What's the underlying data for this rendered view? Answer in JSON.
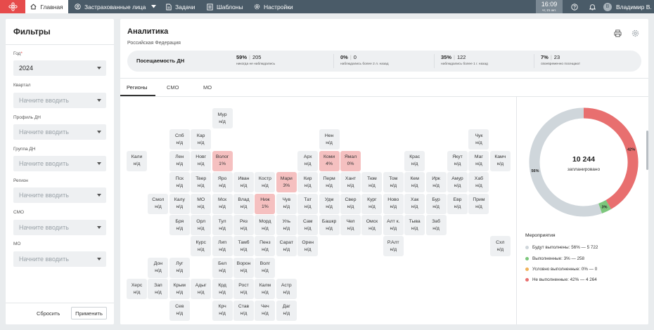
{
  "colors": {
    "topbar": "#4a5b68",
    "accent": "#e64b4b",
    "tile": "#eef0f2",
    "tile_red": "#f5c0c0",
    "planned": "#cfd6db",
    "done": "#7cc77c",
    "conditional": "#f0b35a",
    "not_done": "#e86f6f"
  },
  "topbar": {
    "logo_icon": "flower-logo-icon",
    "nav": [
      {
        "label": "Главная",
        "icon": "home-icon"
      },
      {
        "label": "Застрахованные лица",
        "icon": "person-circle-icon"
      },
      {
        "label": "Задачи",
        "icon": "document-icon"
      },
      {
        "label": "Шаблоны",
        "icon": "template-icon"
      },
      {
        "label": "Настройки",
        "icon": "gear-icon"
      }
    ],
    "time": "16:09",
    "date": "чт, 21 окт.",
    "user_initial": "В",
    "user_name": "Владимир В."
  },
  "filters": {
    "title": "Фильтры",
    "year_label": "Год",
    "year_required": "*",
    "year_value": "2024",
    "fields": [
      {
        "label": "Квартал",
        "placeholder": "Начните вводить"
      },
      {
        "label": "Профиль ДН",
        "placeholder": "Начните вводить"
      },
      {
        "label": "Группа ДН",
        "placeholder": "Начните вводить"
      },
      {
        "label": "Регион",
        "placeholder": "Начните вводить"
      },
      {
        "label": "СМО",
        "placeholder": "Начните вводить"
      },
      {
        "label": "МО",
        "placeholder": "Начните вводить"
      }
    ],
    "reset": "Сбросить",
    "apply": "Применить"
  },
  "main": {
    "title": "Аналитика",
    "subtitle": "Российская Федерация",
    "stats_label": "Посещаемость ДН",
    "stats": [
      {
        "pct": "59%",
        "count": "205",
        "desc": "никогда не наблюдались"
      },
      {
        "pct": "0%",
        "count": "0",
        "desc": "наблюдались более 2 л. назад"
      },
      {
        "pct": "35%",
        "count": "122",
        "desc": "наблюдались более 1 г. назад"
      },
      {
        "pct": "7%",
        "count": "23",
        "desc": "своевременно посещают"
      }
    ],
    "tabs": [
      "Регионы",
      "СМО",
      "МО"
    ],
    "tiles": [
      [
        "Мур",
        "н/д",
        4,
        0,
        0
      ],
      [
        "Спб",
        "н/д",
        2,
        1,
        0
      ],
      [
        "Кар",
        "н/д",
        3,
        1,
        0
      ],
      [
        "Нен",
        "н/д",
        9,
        1,
        0
      ],
      [
        "Чук",
        "н/д",
        16,
        1,
        0
      ],
      [
        "Кали",
        "н/д",
        0,
        2,
        0
      ],
      [
        "Лен",
        "н/д",
        2,
        2,
        0
      ],
      [
        "Новг",
        "н/д",
        3,
        2,
        0
      ],
      [
        "Волог",
        "1%",
        4,
        2,
        1
      ],
      [
        "Арх",
        "н/д",
        8,
        2,
        0
      ],
      [
        "Коми",
        "4%",
        9,
        2,
        1
      ],
      [
        "Ямал",
        "0%",
        10,
        2,
        1
      ],
      [
        "Крас",
        "н/д",
        13,
        2,
        0
      ],
      [
        "Якут",
        "н/д",
        15,
        2,
        0
      ],
      [
        "Маг",
        "н/д",
        16,
        2,
        0
      ],
      [
        "Камч",
        "н/д",
        17,
        2,
        0
      ],
      [
        "Пск",
        "н/д",
        2,
        3,
        0
      ],
      [
        "Твер",
        "н/д",
        3,
        3,
        0
      ],
      [
        "Яро",
        "н/д",
        4,
        3,
        0
      ],
      [
        "Иван",
        "н/д",
        5,
        3,
        0
      ],
      [
        "Костр",
        "н/д",
        6,
        3,
        0
      ],
      [
        "Мари",
        "3%",
        7,
        3,
        1
      ],
      [
        "Кир",
        "н/д",
        8,
        3,
        0
      ],
      [
        "Перм",
        "н/д",
        9,
        3,
        0
      ],
      [
        "Хант",
        "н/д",
        10,
        3,
        0
      ],
      [
        "Тюм",
        "н/д",
        11,
        3,
        0
      ],
      [
        "Том",
        "н/д",
        12,
        3,
        0
      ],
      [
        "Кем",
        "н/д",
        13,
        3,
        0
      ],
      [
        "Ирк",
        "н/д",
        14,
        3,
        0
      ],
      [
        "Амур",
        "н/д",
        15,
        3,
        0
      ],
      [
        "Хаб",
        "н/д",
        16,
        3,
        0
      ],
      [
        "Смол",
        "н/д",
        1,
        4,
        0
      ],
      [
        "Калу",
        "н/д",
        2,
        4,
        0
      ],
      [
        "МО",
        "н/д",
        3,
        4,
        0
      ],
      [
        "Мск",
        "н/д",
        4,
        4,
        0
      ],
      [
        "Влад",
        "н/д",
        5,
        4,
        0
      ],
      [
        "Ниж",
        "1%",
        6,
        4,
        1
      ],
      [
        "Чув",
        "н/д",
        7,
        4,
        0
      ],
      [
        "Тат",
        "н/д",
        8,
        4,
        0
      ],
      [
        "Удм",
        "н/д",
        9,
        4,
        0
      ],
      [
        "Свер",
        "н/д",
        10,
        4,
        0
      ],
      [
        "Кург",
        "н/д",
        11,
        4,
        0
      ],
      [
        "Ново",
        "н/д",
        12,
        4,
        0
      ],
      [
        "Хак",
        "н/д",
        13,
        4,
        0
      ],
      [
        "Бур",
        "н/д",
        14,
        4,
        0
      ],
      [
        "Евр",
        "н/д",
        15,
        4,
        0
      ],
      [
        "Прим",
        "н/д",
        16,
        4,
        0
      ],
      [
        "Бря",
        "н/д",
        2,
        5,
        0
      ],
      [
        "Орл",
        "н/д",
        3,
        5,
        0
      ],
      [
        "Тул",
        "н/д",
        4,
        5,
        0
      ],
      [
        "Ряз",
        "н/д",
        5,
        5,
        0
      ],
      [
        "Морд",
        "н/д",
        6,
        5,
        0
      ],
      [
        "Уль",
        "н/д",
        7,
        5,
        0
      ],
      [
        "Сам",
        "н/д",
        8,
        5,
        0
      ],
      [
        "Башкр",
        "н/д",
        9,
        5,
        0
      ],
      [
        "Чел",
        "н/д",
        10,
        5,
        0
      ],
      [
        "Омск",
        "н/д",
        11,
        5,
        0
      ],
      [
        "Алт к.",
        "н/д",
        12,
        5,
        0
      ],
      [
        "Тыва",
        "н/д",
        13,
        5,
        0
      ],
      [
        "Заб",
        "н/д",
        14,
        5,
        0
      ],
      [
        "Курс",
        "н/д",
        3,
        6,
        0
      ],
      [
        "Лип",
        "н/д",
        4,
        6,
        0
      ],
      [
        "Тамб",
        "н/д",
        5,
        6,
        0
      ],
      [
        "Пенз",
        "н/д",
        6,
        6,
        0
      ],
      [
        "Сарат",
        "н/д",
        7,
        6,
        0
      ],
      [
        "Орен",
        "н/д",
        8,
        6,
        0
      ],
      [
        "Р.Алт",
        "н/д",
        12,
        6,
        0
      ],
      [
        "Схл",
        "н/д",
        17,
        6,
        0
      ],
      [
        "Дон",
        "н/д",
        1,
        7,
        0
      ],
      [
        "Луг",
        "н/д",
        2,
        7,
        0
      ],
      [
        "Бел",
        "н/д",
        4,
        7,
        0
      ],
      [
        "Ворон",
        "н/д",
        5,
        7,
        0
      ],
      [
        "Волг",
        "н/д",
        6,
        7,
        0
      ],
      [
        "Херс",
        "н/д",
        0,
        8,
        0
      ],
      [
        "Зап",
        "н/д",
        1,
        8,
        0
      ],
      [
        "Крым",
        "н/д",
        2,
        8,
        0
      ],
      [
        "Адыг",
        "н/д",
        3,
        8,
        0
      ],
      [
        "Крд",
        "н/д",
        4,
        8,
        0
      ],
      [
        "Рост",
        "н/д",
        5,
        8,
        0
      ],
      [
        "Калм",
        "н/д",
        6,
        8,
        0
      ],
      [
        "Астр",
        "н/д",
        7,
        8,
        0
      ],
      [
        "Сев",
        "н/д",
        2,
        9,
        0
      ],
      [
        "Крч",
        "н/д",
        4,
        9,
        0
      ],
      [
        "Став",
        "н/д",
        5,
        9,
        0
      ],
      [
        "Чеч",
        "н/д",
        6,
        9,
        0
      ],
      [
        "Даг",
        "н/д",
        7,
        9,
        0
      ]
    ]
  },
  "chart_data": {
    "type": "pie",
    "donut": true,
    "total": "10 244",
    "total_label": "запланировано",
    "slices": [
      {
        "label": "Будут выполнены",
        "percent": 56,
        "value": 5722,
        "pct_label": "56%"
      },
      {
        "label": "Выполненные",
        "percent": 3,
        "value": 258,
        "pct_label": "3%"
      },
      {
        "label": "Условно выполненные",
        "percent": 0,
        "value": 0,
        "pct_label": ""
      },
      {
        "label": "Не выполненные",
        "percent": 42,
        "value": 4264,
        "pct_label": "42%"
      }
    ],
    "legend_title": "Мероприятия",
    "legend": [
      "Будут выполнены: 56% — 5 722",
      "Выполненные: 3% — 258",
      "Условно выполненные: 0% — 0",
      "Не выполненные: 42% — 4 264"
    ]
  }
}
